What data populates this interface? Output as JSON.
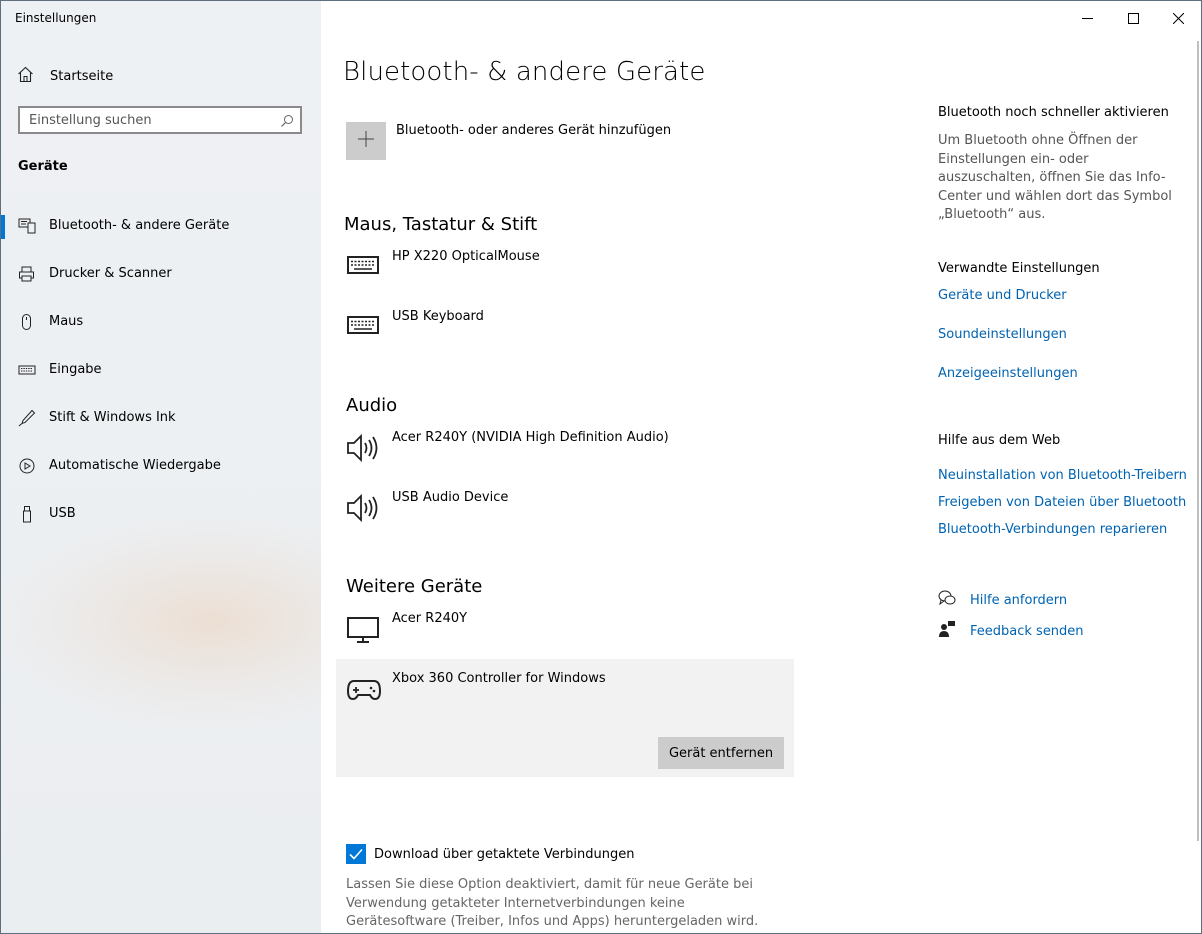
{
  "window": {
    "title": "Einstellungen"
  },
  "sidebar": {
    "home_label": "Startseite",
    "search_placeholder": "Einstellung suchen",
    "group_title": "Geräte",
    "items": [
      {
        "label": "Bluetooth- & andere Geräte",
        "icon": "bluetooth-devices-icon",
        "active": true
      },
      {
        "label": "Drucker & Scanner",
        "icon": "printer-icon"
      },
      {
        "label": "Maus",
        "icon": "mouse-icon"
      },
      {
        "label": "Eingabe",
        "icon": "keyboard-icon"
      },
      {
        "label": "Stift & Windows Ink",
        "icon": "pen-icon"
      },
      {
        "label": "Automatische Wiedergabe",
        "icon": "autoplay-icon"
      },
      {
        "label": "USB",
        "icon": "usb-icon"
      }
    ]
  },
  "main": {
    "title": "Bluetooth- & andere Geräte",
    "add_device_label": "Bluetooth- oder anderes Gerät hinzufügen",
    "sections": {
      "input": {
        "title": "Maus, Tastatur & Stift",
        "devices": [
          "HP X220 OpticalMouse",
          "USB Keyboard"
        ]
      },
      "audio": {
        "title": "Audio",
        "devices": [
          "Acer R240Y (NVIDIA High Definition Audio)",
          "USB Audio Device"
        ]
      },
      "other": {
        "title": "Weitere Geräte",
        "devices": [
          "Acer R240Y",
          "Xbox 360 Controller for Windows"
        ]
      }
    },
    "remove_button_label": "Gerät entfernen",
    "metered_checkbox": {
      "label": "Download über getaktete Verbindungen",
      "checked": true
    },
    "metered_description": "Lassen Sie diese Option deaktiviert, damit für neue Geräte bei Verwendung getakteter Internetverbindungen keine Gerätesoftware (Treiber, Infos und Apps) heruntergeladen wird. So vermeiden Sie"
  },
  "right": {
    "quick_title": "Bluetooth noch schneller aktivieren",
    "quick_text": "Um Bluetooth ohne Öffnen der Einstellungen ein- oder auszuschalten, öffnen Sie das Info-Center und wählen dort das Symbol „Bluetooth“ aus.",
    "related_title": "Verwandte Einstellungen",
    "related_links": [
      "Geräte und Drucker",
      "Soundeinstellungen",
      "Anzeigeeinstellungen"
    ],
    "web_title": "Hilfe aus dem Web",
    "web_links": [
      "Neuinstallation von Bluetooth-Treibern",
      "Freigeben von Dateien über Bluetooth",
      "Bluetooth-Verbindungen reparieren"
    ],
    "help_label": "Hilfe anfordern",
    "feedback_label": "Feedback senden"
  },
  "colors": {
    "accent": "#0078d7",
    "link": "#0063b1",
    "sidebar_bg": "#eef1f4",
    "tile": "#cccccc"
  }
}
